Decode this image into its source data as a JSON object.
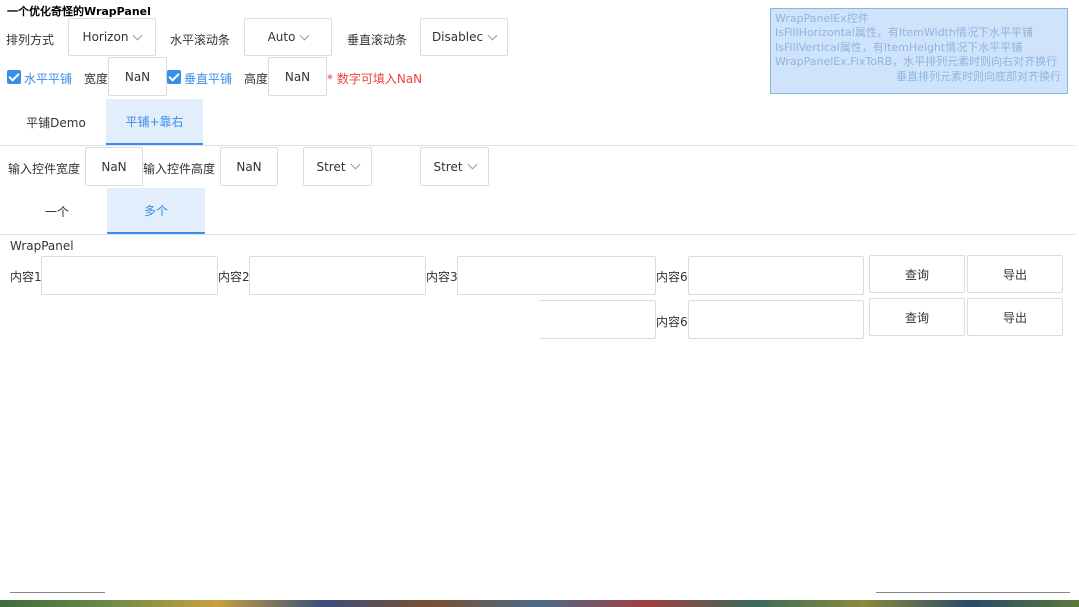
{
  "window": {
    "title": "一个优化奇怪的WrapPanel"
  },
  "options": {
    "orientation_label": "排列方式",
    "orientation_value": "Horizon",
    "hscroll_label": "水平滚动条",
    "hscroll_value": "Auto",
    "vscroll_label": "垂直滚动条",
    "vscroll_value": "Disablec",
    "fill_h_label": "水平平铺",
    "width_label": "宽度",
    "width_value": "NaN",
    "fill_v_label": "垂直平铺",
    "height_label": "高度",
    "height_value": "NaN",
    "nan_hint": "* 数字可填入NaN"
  },
  "info_box": {
    "lines": [
      "WrapPanelEx控件",
      "IsFillHorizontal属性，有ItemWidth情况下水平平铺",
      "IsFillVertical属性，有ItemHeight情况下水平平铺",
      "WrapPanelEx.FixToRB，水平排列元素时则向右对齐换行",
      "垂直排列元素时则向底部对齐换行"
    ]
  },
  "main_tabs": [
    {
      "label": "平铺Demo",
      "active": false
    },
    {
      "label": "平铺+靠右",
      "active": true
    }
  ],
  "controls": {
    "input_width_label": "输入控件宽度",
    "input_width_value": "NaN",
    "input_height_label": "输入控件高度",
    "input_height_value": "NaN",
    "align1_value": "Stret",
    "align2_value": "Stret"
  },
  "sub_tabs": [
    {
      "label": "一个",
      "active": false
    },
    {
      "label": "多个",
      "active": true
    }
  ],
  "panel": {
    "title": "WrapPanel",
    "row1_labels": [
      "内容1",
      "内容2",
      "内容3",
      "内容6"
    ],
    "row2_label": "内容6",
    "query_label": "查询",
    "export_label": "导出"
  }
}
